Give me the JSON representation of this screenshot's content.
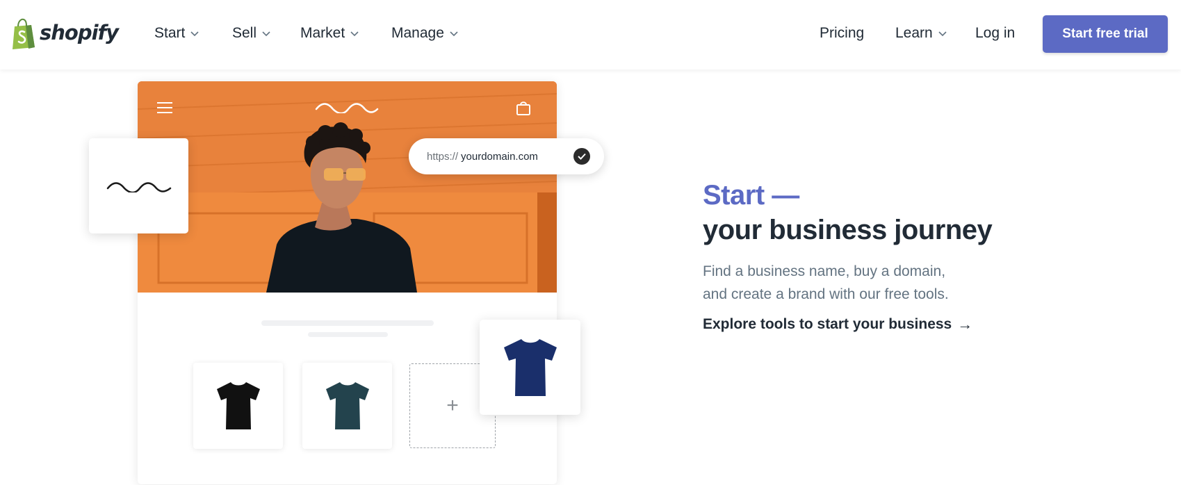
{
  "header": {
    "logo_text": "shopify",
    "nav_left": [
      {
        "label": "Start"
      },
      {
        "label": "Sell"
      },
      {
        "label": "Market"
      },
      {
        "label": "Manage"
      }
    ],
    "pricing": "Pricing",
    "learn": "Learn",
    "login": "Log in",
    "cta": "Start free trial"
  },
  "illustration": {
    "domain_prefix": "https://",
    "domain_name": "yourdomain.com",
    "add_symbol": "+"
  },
  "hero": {
    "title_accent": "Start —",
    "title_main": "your business journey",
    "subtitle_line1": "Find a business name, buy a domain,",
    "subtitle_line2": "and create a brand with our free tools.",
    "link_label": "Explore tools to start your business",
    "link_arrow": "→"
  },
  "colors": {
    "brand_green": "#95bf47",
    "accent_purple": "#5c6ac4",
    "hero_orange": "#e9803b",
    "text_dark": "#212b36"
  },
  "icons": [
    "shopify-bag-icon",
    "chevron-down-icon",
    "menu-icon",
    "bag-icon",
    "checkmark-icon",
    "wave-logo-icon",
    "tshirt-icon",
    "plus-icon",
    "arrow-right-icon"
  ]
}
